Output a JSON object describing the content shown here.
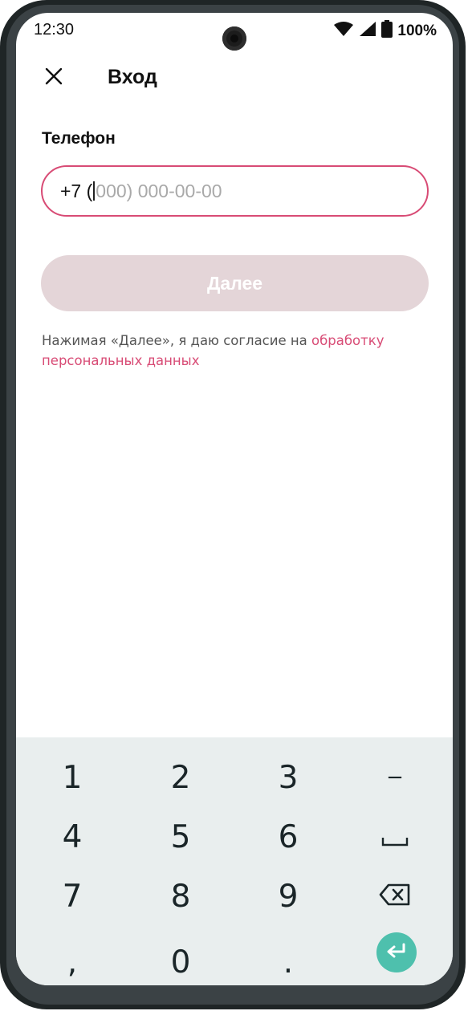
{
  "status_bar": {
    "time": "12:30",
    "battery_percent": "100%",
    "icons": [
      "wifi-icon",
      "signal-icon",
      "battery-icon"
    ]
  },
  "header": {
    "title": "Вход",
    "close_icon": "close-icon"
  },
  "form": {
    "phone_label": "Телефон",
    "phone_prefix": "+7 (",
    "phone_mask": "000) 000-00-00",
    "next_label": "Далее",
    "consent_text": "Нажимая «Далее», я даю согласие на ",
    "consent_link": "обработку персональных данных"
  },
  "keyboard": {
    "rows": [
      [
        "1",
        "2",
        "3",
        "−"
      ],
      [
        "4",
        "5",
        "6",
        "space"
      ],
      [
        "7",
        "8",
        "9",
        "backspace"
      ],
      [
        ",",
        "0",
        ".",
        "enter"
      ]
    ],
    "enter_color": "#4ec0ad"
  },
  "colors": {
    "accent": "#d84b75",
    "button_disabled": "#e4d5d8",
    "keyboard_bg": "#e9eeee"
  }
}
